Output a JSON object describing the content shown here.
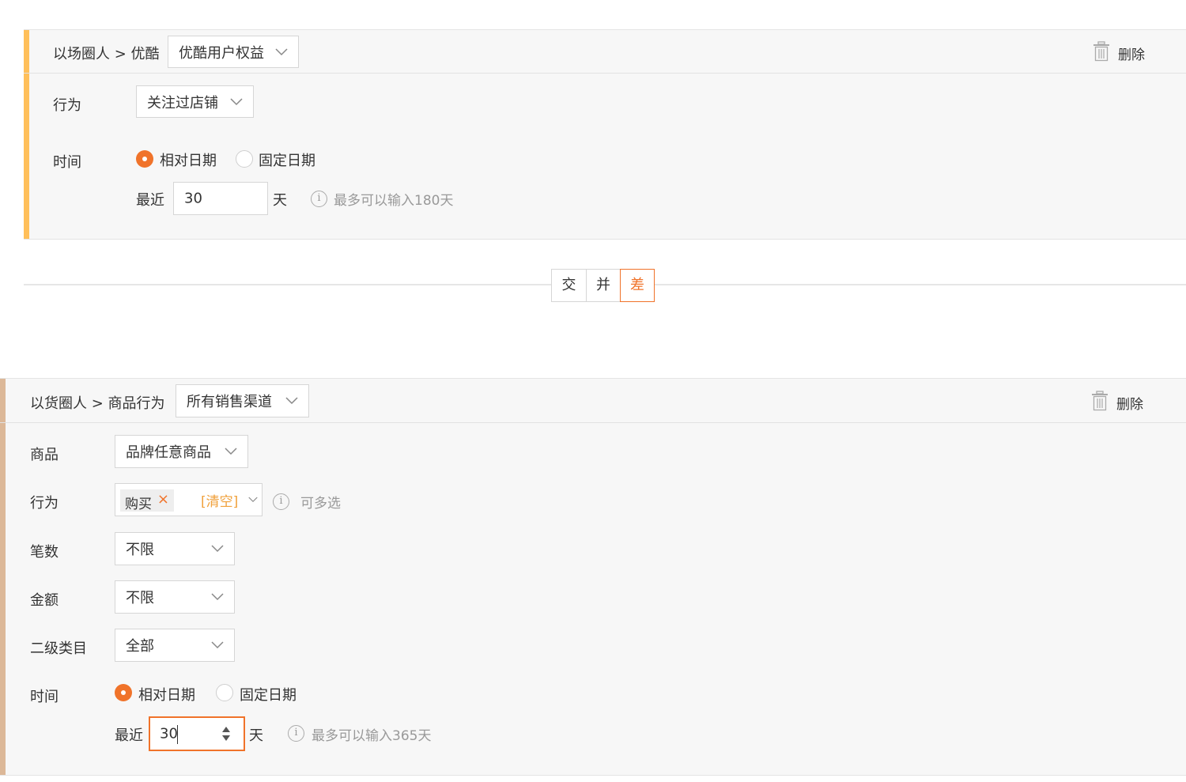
{
  "colors": {
    "accent_orange": "#f0732a",
    "card1_bar": "#ffbf5a",
    "card2_bar": "#dcb898",
    "clear_link": "#f0a03a",
    "hint_gray": "#999999"
  },
  "card1": {
    "breadcrumb": "以场圈人 > 优酷",
    "category_select": "优酷用户权益",
    "delete_label": "删除",
    "behavior_label": "行为",
    "behavior_select": "关注过店铺",
    "time_label": "时间",
    "radio_relative": "相对日期",
    "radio_fixed": "固定日期",
    "recent_label": "最近",
    "days_value": "30",
    "days_unit": "天",
    "hint": "最多可以输入180天",
    "info_icon": "i"
  },
  "operators": {
    "intersect": "交",
    "union": "并",
    "difference": "差",
    "selected": "差"
  },
  "card2": {
    "breadcrumb": "以货圈人 > 商品行为",
    "channel_select": "所有销售渠道",
    "delete_label": "删除",
    "product_label": "商品",
    "product_select": "品牌任意商品",
    "behavior_label": "行为",
    "behavior_tag": "购买",
    "tag_remove": "×",
    "clear_label": "[清空]",
    "multi_hint": "可多选",
    "count_label": "笔数",
    "count_select": "不限",
    "amount_label": "金额",
    "amount_select": "不限",
    "subcategory_label": "二级类目",
    "subcategory_select": "全部",
    "time_label": "时间",
    "radio_relative": "相对日期",
    "radio_fixed": "固定日期",
    "recent_label": "最近",
    "days_value": "30",
    "days_unit": "天",
    "hint": "最多可以输入365天",
    "info_icon": "i"
  }
}
